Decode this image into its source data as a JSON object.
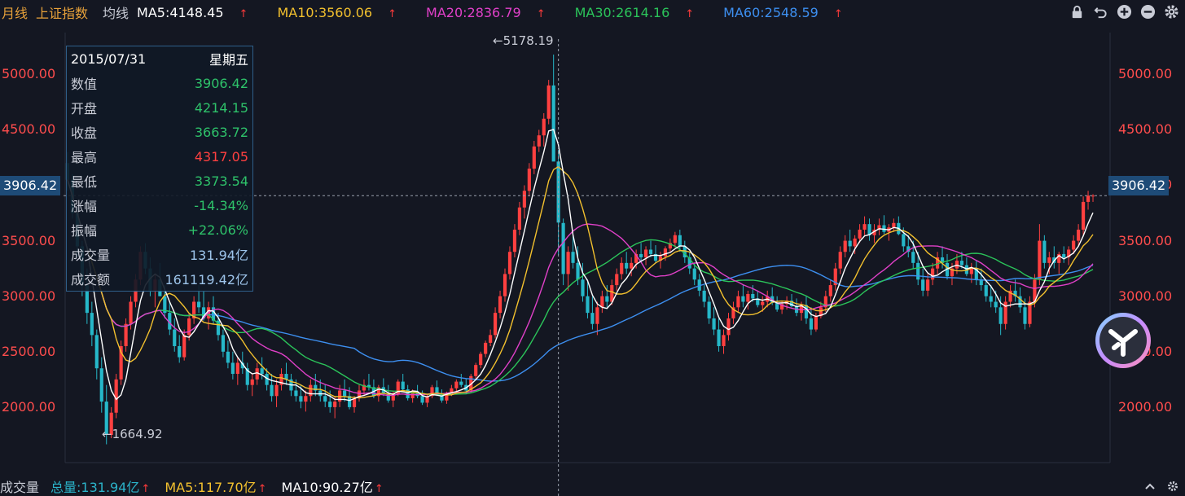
{
  "header": {
    "period": "月线",
    "index_name": "上证指数",
    "ma_label": "均线",
    "ma_items": [
      {
        "text": "MA5:4148.45",
        "color": "#ffffff"
      },
      {
        "text": "MA10:3560.06",
        "color": "#f2c02e"
      },
      {
        "text": "MA20:2836.79",
        "color": "#e040c8"
      },
      {
        "text": "MA30:2614.16",
        "color": "#2bc45a"
      },
      {
        "text": "MA60:2548.59",
        "color": "#3d8ff0"
      }
    ],
    "arrow": "↑",
    "tools": [
      "lock-icon",
      "undo-icon",
      "zoom-in-icon",
      "zoom-out-icon",
      "settings-icon"
    ]
  },
  "info": {
    "date": "2015/07/31",
    "weekday": "星期五",
    "rows": [
      {
        "label": "数值",
        "value": "3906.42",
        "color": "green"
      },
      {
        "label": "开盘",
        "value": "4214.15",
        "color": "green"
      },
      {
        "label": "收盘",
        "value": "3663.72",
        "color": "green"
      },
      {
        "label": "最高",
        "value": "4317.05",
        "color": "red"
      },
      {
        "label": "最低",
        "value": "3373.54",
        "color": "green"
      },
      {
        "label": "涨幅",
        "value": "-14.34%",
        "color": "green"
      },
      {
        "label": "振幅",
        "value": "+22.06%",
        "color": "green"
      },
      {
        "label": "成交量",
        "value": "131.94亿",
        "color": "blue"
      },
      {
        "label": "成交额",
        "value": "161119.42亿",
        "color": "blue"
      }
    ]
  },
  "crosshair_value": "3906.42",
  "annotations": {
    "max": "←5178.19",
    "min": "←1664.92"
  },
  "footer": {
    "volume_label": "成交量",
    "items": [
      {
        "text": "总量:131.94亿",
        "color": "#2bb3c9"
      },
      {
        "text": "MA5:117.70亿",
        "color": "#f2c02e"
      },
      {
        "text": "MA10:90.27亿",
        "color": "#ffffff"
      }
    ],
    "arrow": "↑"
  },
  "chart_data": {
    "type": "candlestick",
    "ylim": [
      1500,
      5450
    ],
    "yticks": [
      2000,
      2500,
      3000,
      3500,
      4000,
      4500,
      5000
    ],
    "ytick_labels": [
      "2000.00",
      "2500.00",
      "3000.00",
      "3500.00",
      "4000.00",
      "4500.00",
      "5000.00"
    ],
    "grid": false,
    "up_color": "#ff4040",
    "down_color": "#26b8c9",
    "crosshair": {
      "x_index": 101,
      "y": 3906.42
    },
    "max_point": {
      "index": 100,
      "value": 5178.19
    },
    "min_point": {
      "index": 8,
      "value": 1664.92
    },
    "ohlc": [
      [
        4200,
        4300,
        3950,
        4050
      ],
      [
        4050,
        4100,
        3700,
        3750
      ],
      [
        3750,
        3800,
        3350,
        3450
      ],
      [
        3450,
        3500,
        3000,
        3100
      ],
      [
        3100,
        3250,
        2750,
        2850
      ],
      [
        2850,
        2950,
        2550,
        2650
      ],
      [
        2650,
        2700,
        2250,
        2350
      ],
      [
        2350,
        2450,
        1950,
        2050
      ],
      [
        2050,
        2200,
        1664.92,
        1750
      ],
      [
        1750,
        2000,
        1720,
        1950
      ],
      [
        1950,
        2300,
        1900,
        2250
      ],
      [
        2250,
        2600,
        2200,
        2550
      ],
      [
        2550,
        2800,
        2500,
        2750
      ],
      [
        2750,
        3000,
        2700,
        2950
      ],
      [
        2950,
        3200,
        2900,
        3150
      ],
      [
        3150,
        3450,
        3100,
        3400
      ],
      [
        3400,
        3478,
        3200,
        3250
      ],
      [
        3250,
        3350,
        3000,
        3050
      ],
      [
        3050,
        3200,
        2900,
        3150
      ],
      [
        3150,
        3300,
        3000,
        3000
      ],
      [
        3000,
        3100,
        2800,
        2850
      ],
      [
        2850,
        2950,
        2650,
        2700
      ],
      [
        2700,
        2800,
        2500,
        2550
      ],
      [
        2550,
        2650,
        2400,
        2450
      ],
      [
        2450,
        2700,
        2420,
        2650
      ],
      [
        2650,
        2850,
        2600,
        2800
      ],
      [
        2800,
        3000,
        2750,
        2950
      ],
      [
        2950,
        3100,
        2850,
        2900
      ],
      [
        2900,
        3050,
        2780,
        2800
      ],
      [
        2800,
        2950,
        2700,
        2900
      ],
      [
        2900,
        3000,
        2750,
        2780
      ],
      [
        2780,
        2850,
        2600,
        2650
      ],
      [
        2650,
        2700,
        2450,
        2500
      ],
      [
        2500,
        2600,
        2350,
        2400
      ],
      [
        2400,
        2500,
        2250,
        2300
      ],
      [
        2300,
        2450,
        2200,
        2400
      ],
      [
        2400,
        2500,
        2300,
        2350
      ],
      [
        2350,
        2400,
        2150,
        2200
      ],
      [
        2200,
        2300,
        2100,
        2250
      ],
      [
        2250,
        2400,
        2200,
        2350
      ],
      [
        2350,
        2450,
        2250,
        2300
      ],
      [
        2300,
        2350,
        2150,
        2200
      ],
      [
        2200,
        2300,
        2050,
        2100
      ],
      [
        2100,
        2250,
        2000,
        2200
      ],
      [
        2200,
        2350,
        2150,
        2300
      ],
      [
        2300,
        2400,
        2200,
        2250
      ],
      [
        2250,
        2300,
        2100,
        2150
      ],
      [
        2150,
        2250,
        2050,
        2100
      ],
      [
        2100,
        2200,
        1990,
        2050
      ],
      [
        2050,
        2150,
        1960,
        2100
      ],
      [
        2100,
        2250,
        2050,
        2200
      ],
      [
        2200,
        2300,
        2100,
        2150
      ],
      [
        2150,
        2250,
        2050,
        2100
      ],
      [
        2100,
        2200,
        2000,
        2050
      ],
      [
        2050,
        2150,
        1950,
        2000
      ],
      [
        2000,
        2100,
        1900,
        2050
      ],
      [
        2050,
        2200,
        2000,
        2150
      ],
      [
        2150,
        2250,
        2050,
        2100
      ],
      [
        2100,
        2180,
        1980,
        2000
      ],
      [
        2000,
        2100,
        1950,
        2080
      ],
      [
        2080,
        2200,
        2050,
        2150
      ],
      [
        2150,
        2250,
        2100,
        2200
      ],
      [
        2200,
        2300,
        2150,
        2180
      ],
      [
        2180,
        2250,
        2080,
        2100
      ],
      [
        2100,
        2200,
        2050,
        2180
      ],
      [
        2180,
        2260,
        2100,
        2120
      ],
      [
        2120,
        2200,
        2040,
        2060
      ],
      [
        2060,
        2150,
        2000,
        2120
      ],
      [
        2120,
        2250,
        2100,
        2230
      ],
      [
        2230,
        2300,
        2150,
        2160
      ],
      [
        2160,
        2200,
        2060,
        2080
      ],
      [
        2080,
        2160,
        2040,
        2140
      ],
      [
        2140,
        2200,
        2080,
        2100
      ],
      [
        2100,
        2150,
        2020,
        2040
      ],
      [
        2040,
        2120,
        2000,
        2100
      ],
      [
        2100,
        2200,
        2080,
        2180
      ],
      [
        2180,
        2240,
        2100,
        2120
      ],
      [
        2120,
        2160,
        2040,
        2060
      ],
      [
        2060,
        2140,
        2030,
        2120
      ],
      [
        2120,
        2200,
        2100,
        2170
      ],
      [
        2170,
        2250,
        2140,
        2230
      ],
      [
        2230,
        2300,
        2180,
        2200
      ],
      [
        2200,
        2260,
        2120,
        2150
      ],
      [
        2150,
        2300,
        2130,
        2280
      ],
      [
        2280,
        2400,
        2250,
        2380
      ],
      [
        2380,
        2500,
        2350,
        2480
      ],
      [
        2480,
        2600,
        2450,
        2580
      ],
      [
        2580,
        2700,
        2550,
        2650
      ],
      [
        2650,
        2900,
        2620,
        2850
      ],
      [
        2850,
        3050,
        2800,
        3000
      ],
      [
        3000,
        3250,
        2950,
        3200
      ],
      [
        3200,
        3450,
        3150,
        3400
      ],
      [
        3400,
        3650,
        3350,
        3600
      ],
      [
        3600,
        3850,
        3550,
        3800
      ],
      [
        3800,
        4000,
        3700,
        3950
      ],
      [
        3950,
        4200,
        3900,
        4150
      ],
      [
        4150,
        4400,
        4100,
        4350
      ],
      [
        4350,
        4500,
        4300,
        4450
      ],
      [
        4450,
        4650,
        4350,
        4600
      ],
      [
        4600,
        4950,
        4550,
        4900
      ],
      [
        4900,
        5178.19,
        4300,
        4214
      ],
      [
        4214.15,
        4317.05,
        3373.54,
        3663.72
      ],
      [
        3660,
        3700,
        3100,
        3200
      ],
      [
        3200,
        3450,
        3050,
        3400
      ],
      [
        3400,
        3550,
        3250,
        3300
      ],
      [
        3300,
        3450,
        3100,
        3150
      ],
      [
        3150,
        3300,
        2950,
        3000
      ],
      [
        3000,
        3150,
        2800,
        2850
      ],
      [
        2850,
        3000,
        2700,
        2750
      ],
      [
        2750,
        2950,
        2650,
        2900
      ],
      [
        2900,
        3050,
        2850,
        3000
      ],
      [
        3000,
        3100,
        2900,
        2950
      ],
      [
        2950,
        3150,
        2920,
        3100
      ],
      [
        3100,
        3250,
        3050,
        3200
      ],
      [
        3200,
        3350,
        3150,
        3300
      ],
      [
        3300,
        3400,
        3200,
        3250
      ],
      [
        3250,
        3350,
        3180,
        3300
      ],
      [
        3300,
        3420,
        3250,
        3380
      ],
      [
        3380,
        3480,
        3300,
        3350
      ],
      [
        3350,
        3450,
        3280,
        3420
      ],
      [
        3420,
        3500,
        3350,
        3380
      ],
      [
        3380,
        3460,
        3300,
        3320
      ],
      [
        3320,
        3400,
        3250,
        3360
      ],
      [
        3360,
        3450,
        3320,
        3430
      ],
      [
        3430,
        3520,
        3400,
        3480
      ],
      [
        3480,
        3580,
        3440,
        3550
      ],
      [
        3550,
        3600,
        3400,
        3450
      ],
      [
        3450,
        3500,
        3300,
        3350
      ],
      [
        3350,
        3400,
        3200,
        3250
      ],
      [
        3250,
        3300,
        3100,
        3150
      ],
      [
        3150,
        3200,
        3000,
        3050
      ],
      [
        3050,
        3100,
        2900,
        2950
      ],
      [
        2950,
        3000,
        2750,
        2800
      ],
      [
        2800,
        2900,
        2650,
        2700
      ],
      [
        2700,
        2800,
        2500,
        2550
      ],
      [
        2550,
        2700,
        2480,
        2650
      ],
      [
        2650,
        2850,
        2600,
        2800
      ],
      [
        2800,
        2950,
        2750,
        2900
      ],
      [
        2900,
        3050,
        2850,
        3000
      ],
      [
        3000,
        3100,
        2900,
        2950
      ],
      [
        2950,
        3050,
        2880,
        3020
      ],
      [
        3020,
        3100,
        2950,
        2980
      ],
      [
        2980,
        3050,
        2900,
        2920
      ],
      [
        2920,
        3000,
        2860,
        2950
      ],
      [
        2950,
        3050,
        2900,
        3000
      ],
      [
        3000,
        3080,
        2920,
        2940
      ],
      [
        2940,
        3000,
        2860,
        2880
      ],
      [
        2880,
        2960,
        2840,
        2930
      ],
      [
        2930,
        3000,
        2880,
        2960
      ],
      [
        2960,
        3020,
        2900,
        2910
      ],
      [
        2910,
        2980,
        2820,
        2850
      ],
      [
        2850,
        2950,
        2780,
        2920
      ],
      [
        2920,
        3000,
        2750,
        2800
      ],
      [
        2800,
        2900,
        2650,
        2700
      ],
      [
        2700,
        2850,
        2680,
        2820
      ],
      [
        2820,
        2950,
        2800,
        2900
      ],
      [
        2900,
        3050,
        2860,
        3000
      ],
      [
        3000,
        3150,
        2950,
        3100
      ],
      [
        3100,
        3300,
        3050,
        3250
      ],
      [
        3250,
        3450,
        3200,
        3400
      ],
      [
        3400,
        3550,
        3350,
        3500
      ],
      [
        3500,
        3600,
        3400,
        3450
      ],
      [
        3450,
        3550,
        3380,
        3520
      ],
      [
        3520,
        3650,
        3480,
        3600
      ],
      [
        3600,
        3720,
        3550,
        3650
      ],
      [
        3650,
        3700,
        3500,
        3550
      ],
      [
        3550,
        3650,
        3480,
        3600
      ],
      [
        3600,
        3700,
        3550,
        3640
      ],
      [
        3640,
        3730,
        3560,
        3580
      ],
      [
        3580,
        3650,
        3500,
        3620
      ],
      [
        3620,
        3700,
        3580,
        3660
      ],
      [
        3660,
        3720,
        3550,
        3560
      ],
      [
        3560,
        3620,
        3400,
        3450
      ],
      [
        3450,
        3550,
        3350,
        3400
      ],
      [
        3400,
        3500,
        3250,
        3300
      ],
      [
        3300,
        3400,
        3100,
        3150
      ],
      [
        3150,
        3250,
        3000,
        3050
      ],
      [
        3050,
        3200,
        3000,
        3150
      ],
      [
        3150,
        3300,
        3100,
        3250
      ],
      [
        3250,
        3400,
        3200,
        3350
      ],
      [
        3350,
        3450,
        3250,
        3300
      ],
      [
        3300,
        3380,
        3150,
        3180
      ],
      [
        3180,
        3300,
        3100,
        3250
      ],
      [
        3250,
        3380,
        3200,
        3320
      ],
      [
        3320,
        3400,
        3250,
        3280
      ],
      [
        3280,
        3350,
        3180,
        3200
      ],
      [
        3200,
        3300,
        3120,
        3250
      ],
      [
        3250,
        3320,
        3100,
        3150
      ],
      [
        3150,
        3250,
        3050,
        3100
      ],
      [
        3100,
        3150,
        2950,
        3000
      ],
      [
        3000,
        3100,
        2900,
        2950
      ],
      [
        2950,
        3050,
        2850,
        2900
      ],
      [
        2900,
        3000,
        2650,
        2750
      ],
      [
        2750,
        3000,
        2700,
        2950
      ],
      [
        2950,
        3100,
        2900,
        3050
      ],
      [
        3050,
        3150,
        2950,
        3000
      ],
      [
        3000,
        3080,
        2850,
        2900
      ],
      [
        2900,
        2980,
        2700,
        2750
      ],
      [
        2750,
        3000,
        2720,
        2950
      ],
      [
        2950,
        3200,
        2900,
        3150
      ],
      [
        3150,
        3650,
        3100,
        3500
      ],
      [
        3500,
        3550,
        3250,
        3300
      ],
      [
        3300,
        3400,
        3200,
        3350
      ],
      [
        3350,
        3450,
        3250,
        3300
      ],
      [
        3300,
        3400,
        3200,
        3380
      ],
      [
        3380,
        3450,
        3300,
        3350
      ],
      [
        3350,
        3450,
        3280,
        3420
      ],
      [
        3420,
        3550,
        3380,
        3500
      ],
      [
        3500,
        3650,
        3450,
        3600
      ],
      [
        3600,
        3900,
        3550,
        3850
      ],
      [
        3850,
        3950,
        3780,
        3906.42
      ],
      [
        3906.42,
        3920,
        3850,
        3906.42
      ]
    ]
  }
}
